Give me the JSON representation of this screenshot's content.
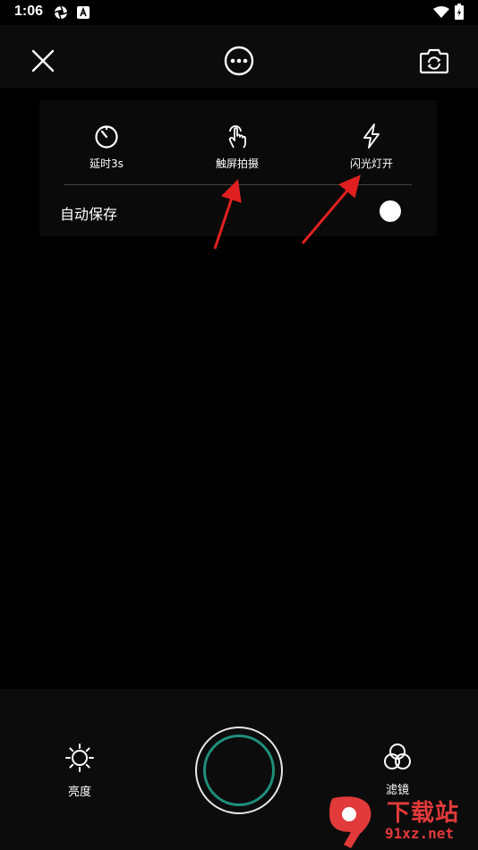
{
  "status_bar": {
    "time": "1:06"
  },
  "settings": {
    "items": [
      {
        "label": "延时3s",
        "icon": "timer-icon"
      },
      {
        "label": "触屏拍摄",
        "icon": "touch-capture-icon"
      },
      {
        "label": "闪光灯开",
        "icon": "flash-icon"
      }
    ],
    "autosave_label": "自动保存"
  },
  "bottom": {
    "brightness_label": "亮度",
    "filter_label": "滤镜"
  },
  "watermark": {
    "text": "下载站",
    "domain": "91xz.net"
  },
  "colors": {
    "accent": "#1f8f7a",
    "annotation": "#e02020"
  }
}
